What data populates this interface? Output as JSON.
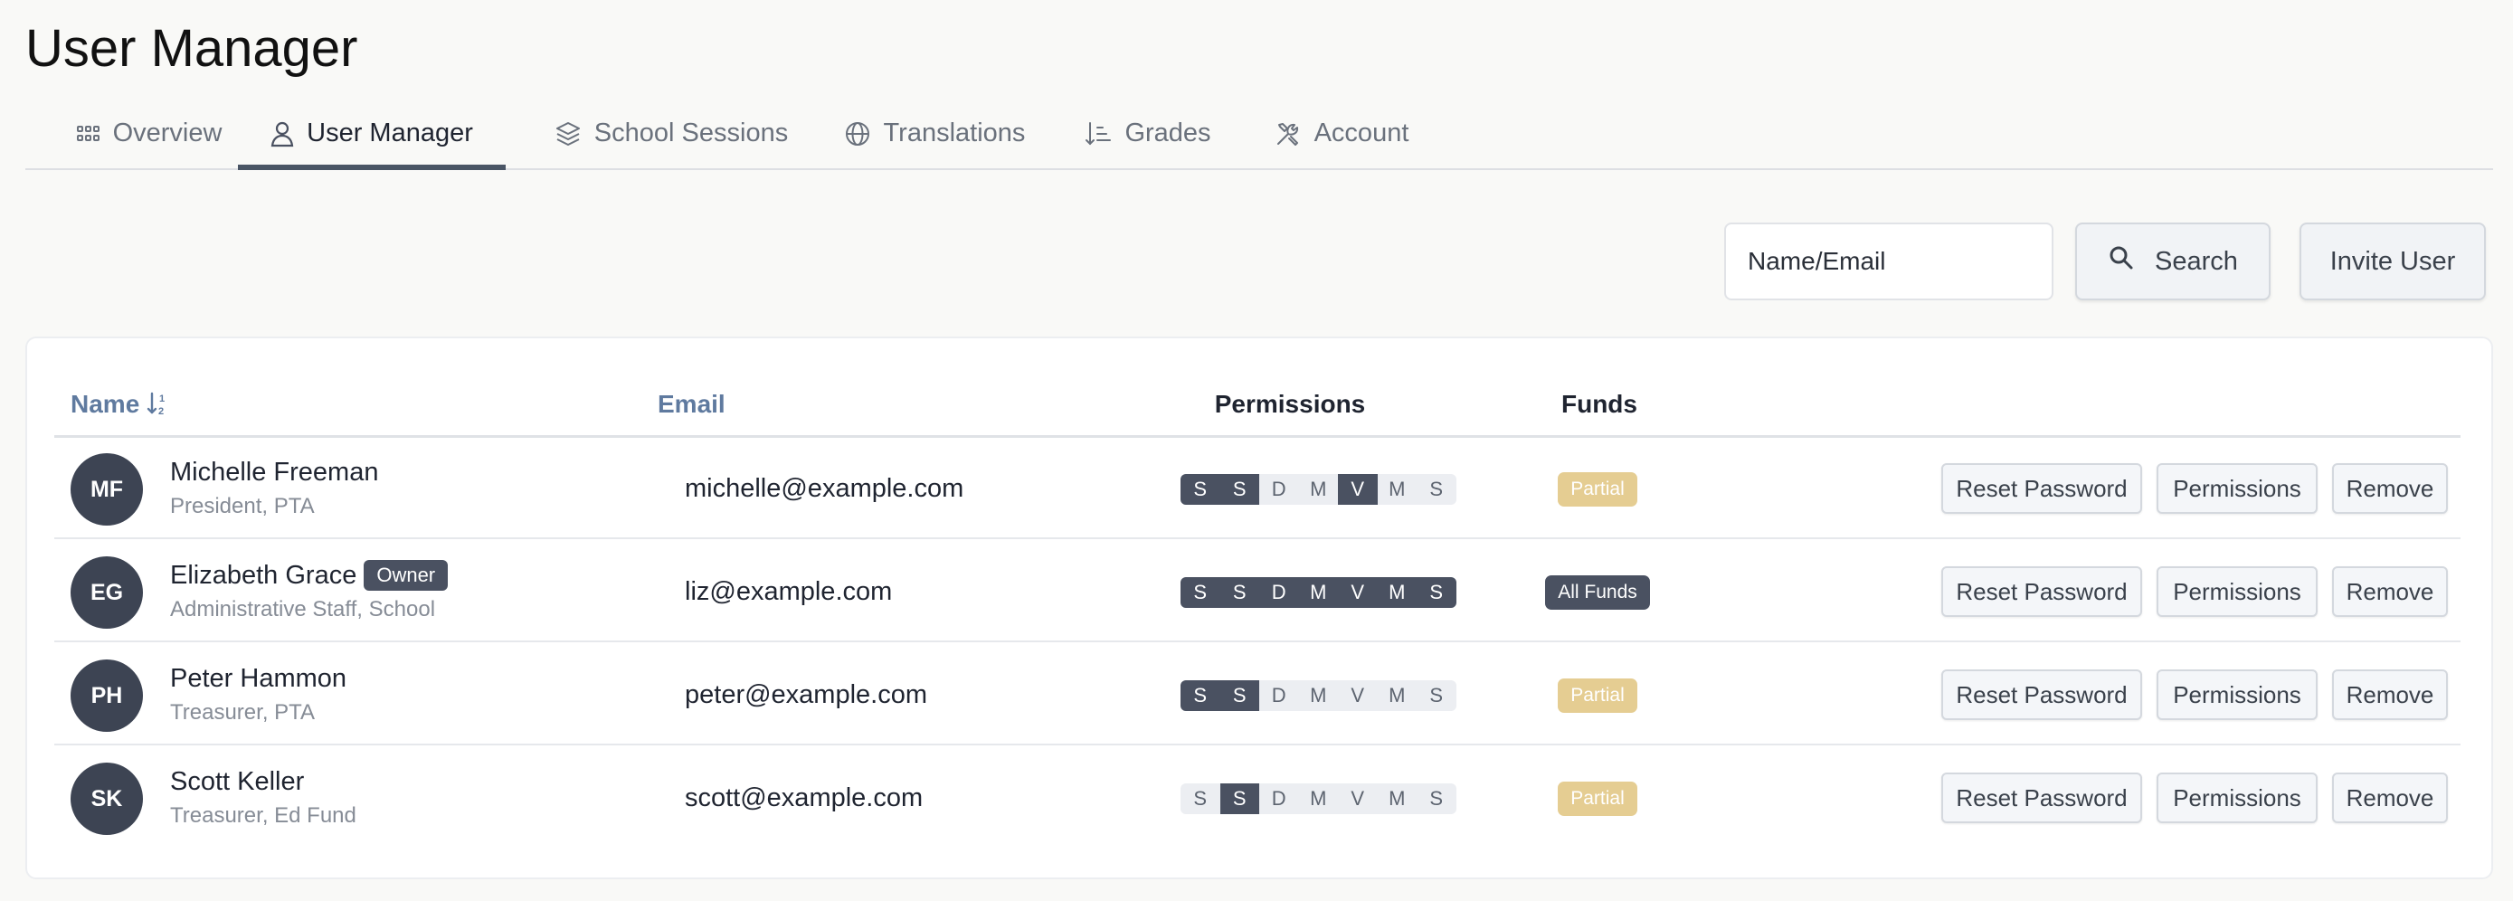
{
  "page": {
    "title": "User Manager"
  },
  "tabs": [
    {
      "label": "Overview",
      "icon": "grid-icon",
      "active": false
    },
    {
      "label": "User Manager",
      "icon": "user-icon",
      "active": true
    },
    {
      "label": "School Sessions",
      "icon": "layers-icon",
      "active": false
    },
    {
      "label": "Translations",
      "icon": "globe-icon",
      "active": false
    },
    {
      "label": "Grades",
      "icon": "sort-list-icon",
      "active": false
    },
    {
      "label": "Account",
      "icon": "tools-icon",
      "active": false
    }
  ],
  "toolbar": {
    "search_placeholder": "Name/Email",
    "search_value": "",
    "search_label": "Search",
    "invite_label": "Invite User"
  },
  "table": {
    "headers": {
      "name": "Name",
      "email": "Email",
      "permissions": "Permissions",
      "funds": "Funds"
    },
    "permission_letters": [
      "S",
      "S",
      "D",
      "M",
      "V",
      "M",
      "S"
    ],
    "action_labels": {
      "reset": "Reset Password",
      "permissions": "Permissions",
      "remove": "Remove"
    },
    "rows": [
      {
        "initials": "MF",
        "name": "Michelle Freeman",
        "badge": "",
        "role": "President, PTA",
        "email": "michelle@example.com",
        "permissions": [
          true,
          true,
          false,
          false,
          true,
          false,
          false
        ],
        "funds": "Partial"
      },
      {
        "initials": "EG",
        "name": "Elizabeth Grace",
        "badge": "Owner",
        "role": "Administrative Staff, School",
        "email": "liz@example.com",
        "permissions": [
          true,
          true,
          true,
          true,
          true,
          true,
          true
        ],
        "funds": "All Funds"
      },
      {
        "initials": "PH",
        "name": "Peter Hammon",
        "badge": "",
        "role": "Treasurer, PTA",
        "email": "peter@example.com",
        "permissions": [
          true,
          true,
          false,
          false,
          false,
          false,
          false
        ],
        "funds": "Partial"
      },
      {
        "initials": "SK",
        "name": "Scott Keller",
        "badge": "",
        "role": "Treasurer, Ed Fund",
        "email": "scott@example.com",
        "permissions": [
          false,
          true,
          false,
          false,
          false,
          false,
          false
        ],
        "funds": "Partial"
      }
    ]
  },
  "colors": {
    "accent": "#4a5565",
    "sortable_header": "#5f7a9f",
    "partial_badge": "#e5cd92",
    "active_permission": "#4a5161"
  }
}
